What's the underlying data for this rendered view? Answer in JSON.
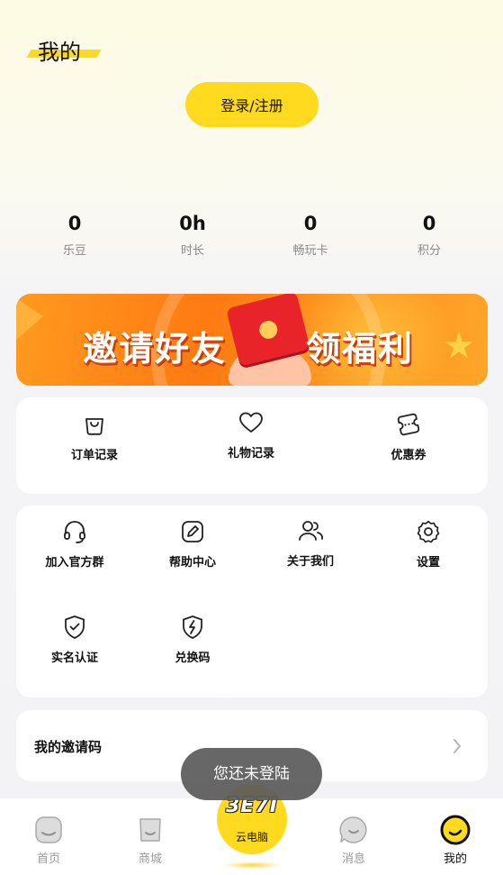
{
  "header": {
    "title": "我的"
  },
  "auth": {
    "login_label": "登录/注册"
  },
  "stats": [
    {
      "value": "0",
      "label": "乐豆"
    },
    {
      "value": "0h",
      "label": "时长"
    },
    {
      "value": "0",
      "label": "畅玩卡"
    },
    {
      "value": "0",
      "label": "积分"
    }
  ],
  "banner": {
    "text_left": "邀请好友",
    "text_right": "领福利"
  },
  "records": [
    {
      "label": "订单记录",
      "icon": "shopping-bag-icon"
    },
    {
      "label": "礼物记录",
      "icon": "heart-icon"
    },
    {
      "label": "优惠券",
      "icon": "coupon-icon"
    }
  ],
  "services": [
    {
      "label": "加入官方群",
      "icon": "headset-icon"
    },
    {
      "label": "帮助中心",
      "icon": "pencil-icon"
    },
    {
      "label": "关于我们",
      "icon": "users-icon"
    },
    {
      "label": "设置",
      "icon": "gear-icon"
    },
    {
      "label": "实名认证",
      "icon": "shield-check-icon"
    },
    {
      "label": "兑换码",
      "icon": "bolt-shield-icon"
    }
  ],
  "invite": {
    "label": "我的邀请码"
  },
  "toast": {
    "text": "您还未登陆"
  },
  "tabbar": {
    "tabs": [
      {
        "label": "首页",
        "icon": "home-icon"
      },
      {
        "label": "商城",
        "icon": "shop-icon"
      },
      {
        "label": "消息",
        "icon": "message-icon"
      },
      {
        "label": "我的",
        "icon": "profile-icon"
      }
    ],
    "center": {
      "logo": "3E7I",
      "label": "云电脑"
    }
  },
  "colors": {
    "accent": "#ffda1e",
    "banner": "#ff7a12",
    "toast_bg": "#5a5a5a"
  }
}
